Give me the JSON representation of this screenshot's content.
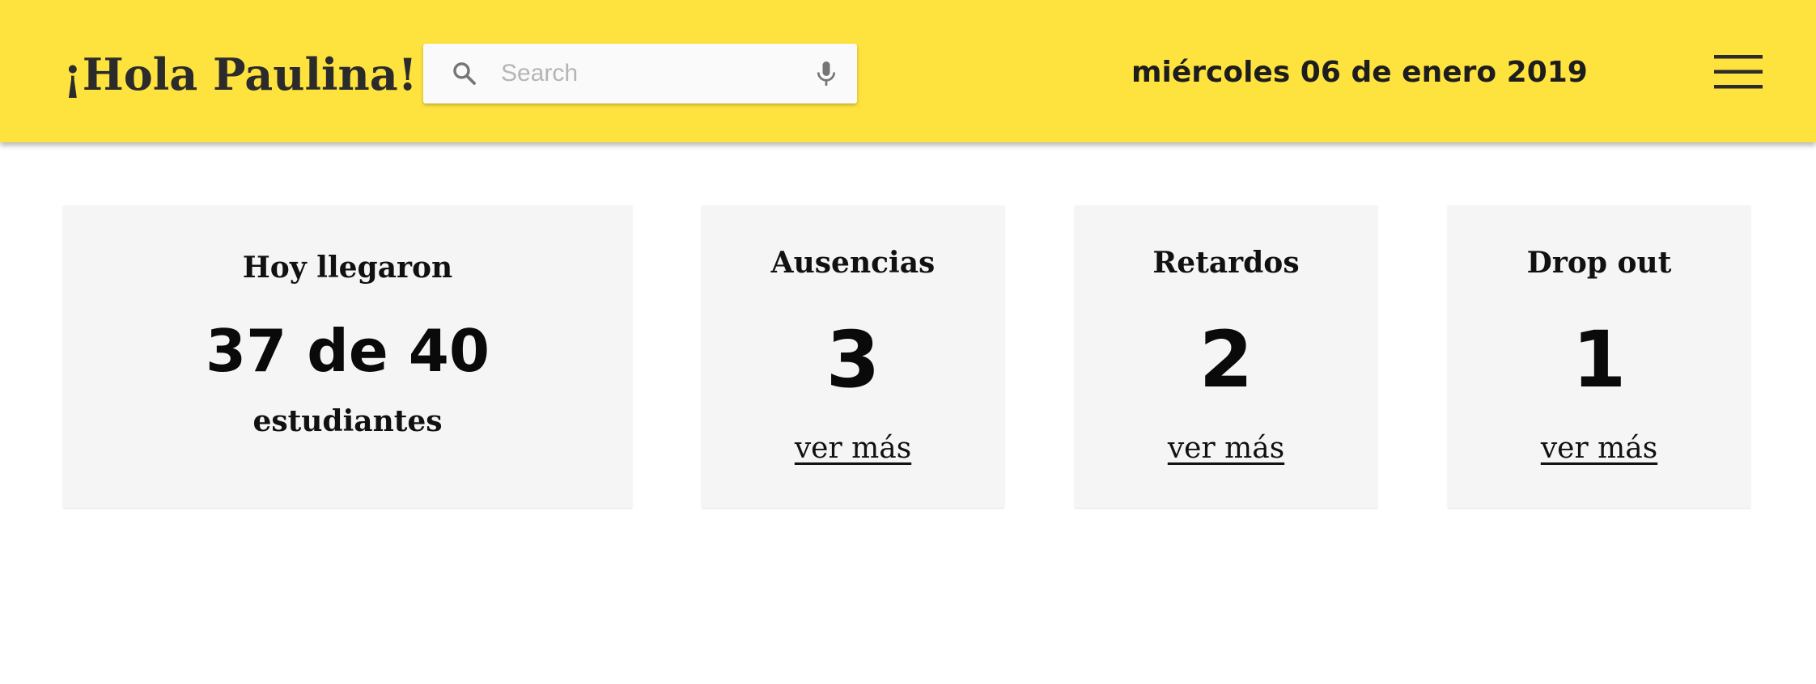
{
  "header": {
    "greeting": "¡Hola Paulina!",
    "search_placeholder": "Search",
    "date": "miércoles 06 de enero 2019",
    "background_color": "#fee33f",
    "icons": [
      "search-icon",
      "mic-icon",
      "menu-icon"
    ]
  },
  "summary": {
    "title": "Hoy llegaron",
    "value": "37 de 40",
    "subtitle": "estudiantes"
  },
  "stats": [
    {
      "title": "Ausencias",
      "value": "3",
      "link": "ver más"
    },
    {
      "title": "Retardos",
      "value": "2",
      "link": "ver más"
    },
    {
      "title": "Drop out",
      "value": "1",
      "link": "ver más"
    }
  ]
}
